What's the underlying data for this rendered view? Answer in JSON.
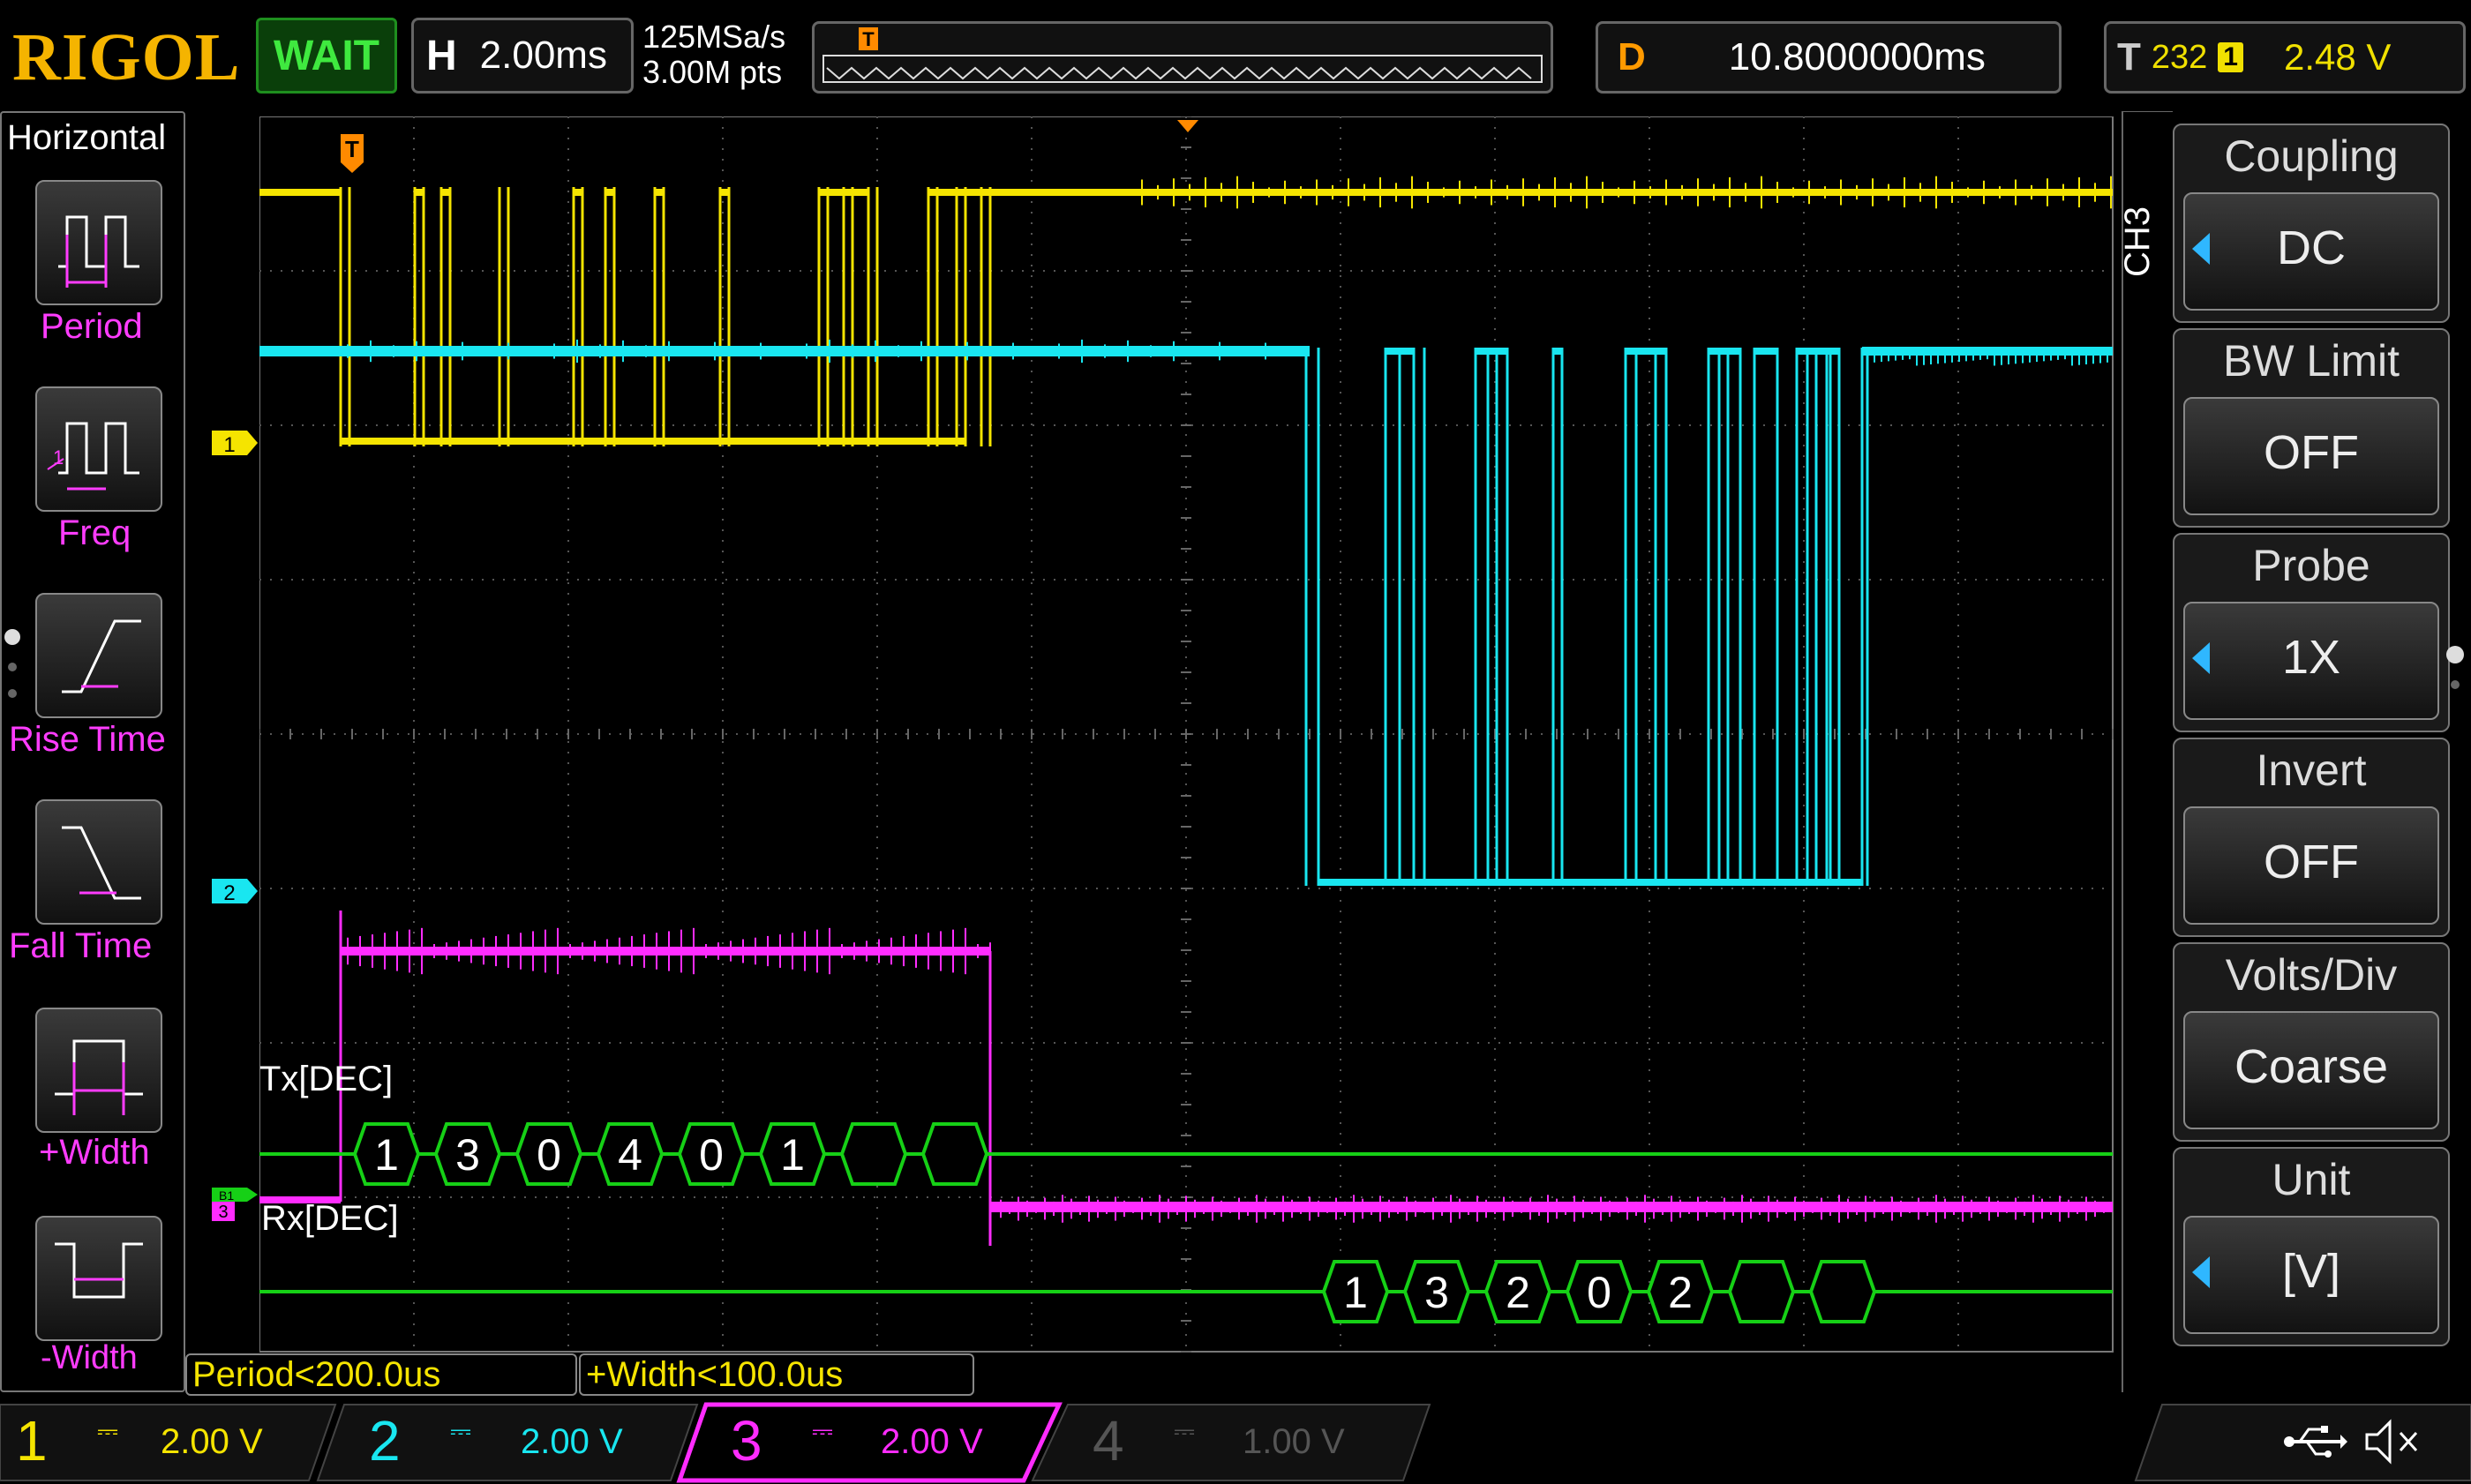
{
  "brand": "RIGOL",
  "run_state": "WAIT",
  "timebase": {
    "key": "H",
    "value": "2.00ms"
  },
  "acquisition": {
    "sample_rate": "125MSa/s",
    "memory_depth": "3.00M pts"
  },
  "delay": {
    "key": "D",
    "value": "10.8000000ms"
  },
  "trigger": {
    "key": "T",
    "count": "232",
    "source": "1",
    "level": "2.48 V",
    "marker": "T"
  },
  "left_menu": {
    "title": "Horizontal",
    "items": [
      {
        "label": "Period",
        "icon": "period-icon"
      },
      {
        "label": "Freq",
        "icon": "freq-icon"
      },
      {
        "label": "Rise Time",
        "icon": "rise-time-icon"
      },
      {
        "label": "Fall Time",
        "icon": "fall-time-icon"
      },
      {
        "label": "+Width",
        "icon": "positive-width-icon"
      },
      {
        "label": "-Width",
        "icon": "negative-width-icon"
      }
    ]
  },
  "right_menu": {
    "channel": "CH3",
    "items": [
      {
        "title": "Coupling",
        "value": "DC",
        "has_arrow": true
      },
      {
        "title": "BW Limit",
        "value": "OFF",
        "has_arrow": false
      },
      {
        "title": "Probe",
        "value": "1X",
        "has_arrow": true
      },
      {
        "title": "Invert",
        "value": "OFF",
        "has_arrow": false
      },
      {
        "title": "Volts/Div",
        "value": "Coarse",
        "has_arrow": false
      },
      {
        "title": "Unit",
        "value": "[V]",
        "has_arrow": true
      }
    ]
  },
  "waveform": {
    "channel_markers": [
      "1",
      "2",
      "3"
    ],
    "decode": {
      "tx_label": "Tx[DEC]",
      "tx_values": [
        "1",
        "3",
        "0",
        "4",
        "0",
        "1",
        "",
        ""
      ],
      "rx_label": "Rx[DEC]",
      "rx_values": [
        "1",
        "3",
        "2",
        "0",
        "2",
        "",
        ""
      ],
      "bus_marker": "B1"
    }
  },
  "measurements": {
    "period": "Period<200.0us",
    "width": "+Width<100.0us"
  },
  "channels": [
    {
      "num": "1",
      "scale": "2.00 V",
      "color": "#f5e400"
    },
    {
      "num": "2",
      "scale": "2.00 V",
      "color": "#19e6f0"
    },
    {
      "num": "3",
      "scale": "2.00 V",
      "color": "#ff2cff"
    },
    {
      "num": "4",
      "scale": "1.00 V",
      "color": "#555555"
    }
  ],
  "colors": {
    "ch1": "#f5e400",
    "ch2": "#19e6f0",
    "ch3": "#ff2cff",
    "decode": "#16d016",
    "accent": "#ff9a00"
  },
  "status_icons": [
    "usb-icon",
    "sound-muted-icon"
  ]
}
